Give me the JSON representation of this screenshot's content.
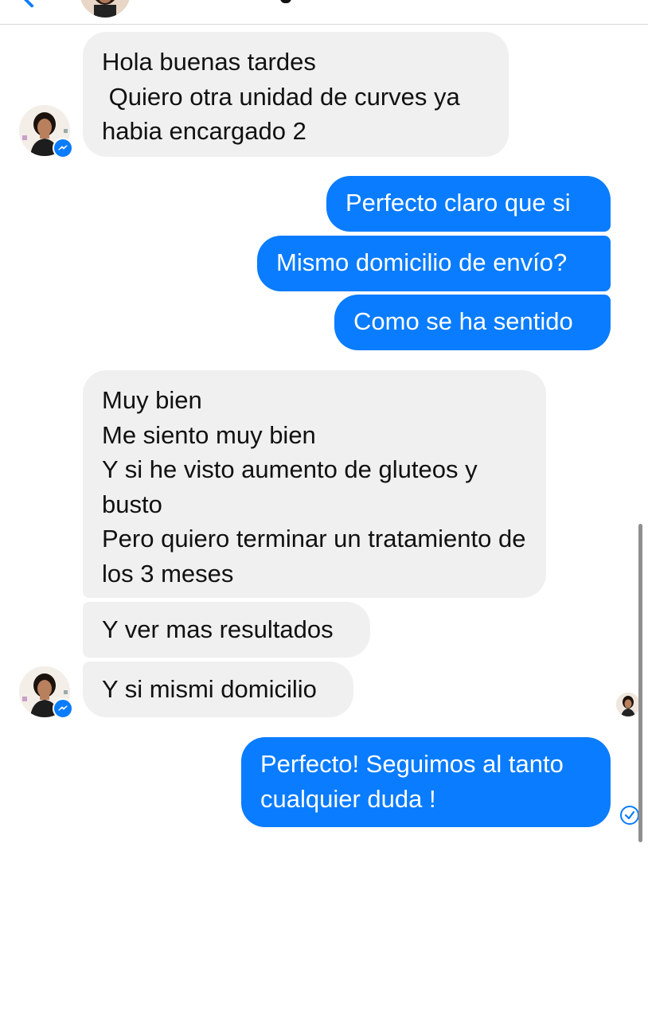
{
  "header": {
    "back_icon": "chevron-left-icon",
    "avatar_icon": "contact-avatar-icon"
  },
  "messages": [
    {
      "direction": "incoming",
      "text": "Hola buenas tardes\n Quiero otra unidad de curves ya habia encargado 2"
    },
    {
      "direction": "outgoing",
      "text": "Perfecto claro que si"
    },
    {
      "direction": "outgoing",
      "text": "Mismo domicilio de envío?"
    },
    {
      "direction": "outgoing",
      "text": "Como se ha sentido"
    },
    {
      "direction": "incoming",
      "text": "Muy bien\nMe siento muy bien\nY si he visto aumento de gluteos y busto\nPero quiero terminar un tratamiento de los 3 meses"
    },
    {
      "direction": "incoming",
      "text": "Y ver mas resultados"
    },
    {
      "direction": "incoming",
      "text": "Y si mismi domicilio"
    },
    {
      "direction": "outgoing",
      "text": "Perfecto! Seguimos al tanto cualquier duda !"
    }
  ],
  "status": {
    "read_receipt_icon": "seen-avatar-icon",
    "sent_icon": "delivered-check-icon"
  },
  "colors": {
    "outgoing_bubble": "#0a7cff",
    "incoming_bubble": "#f0f0f0",
    "accent": "#0a7cff"
  }
}
